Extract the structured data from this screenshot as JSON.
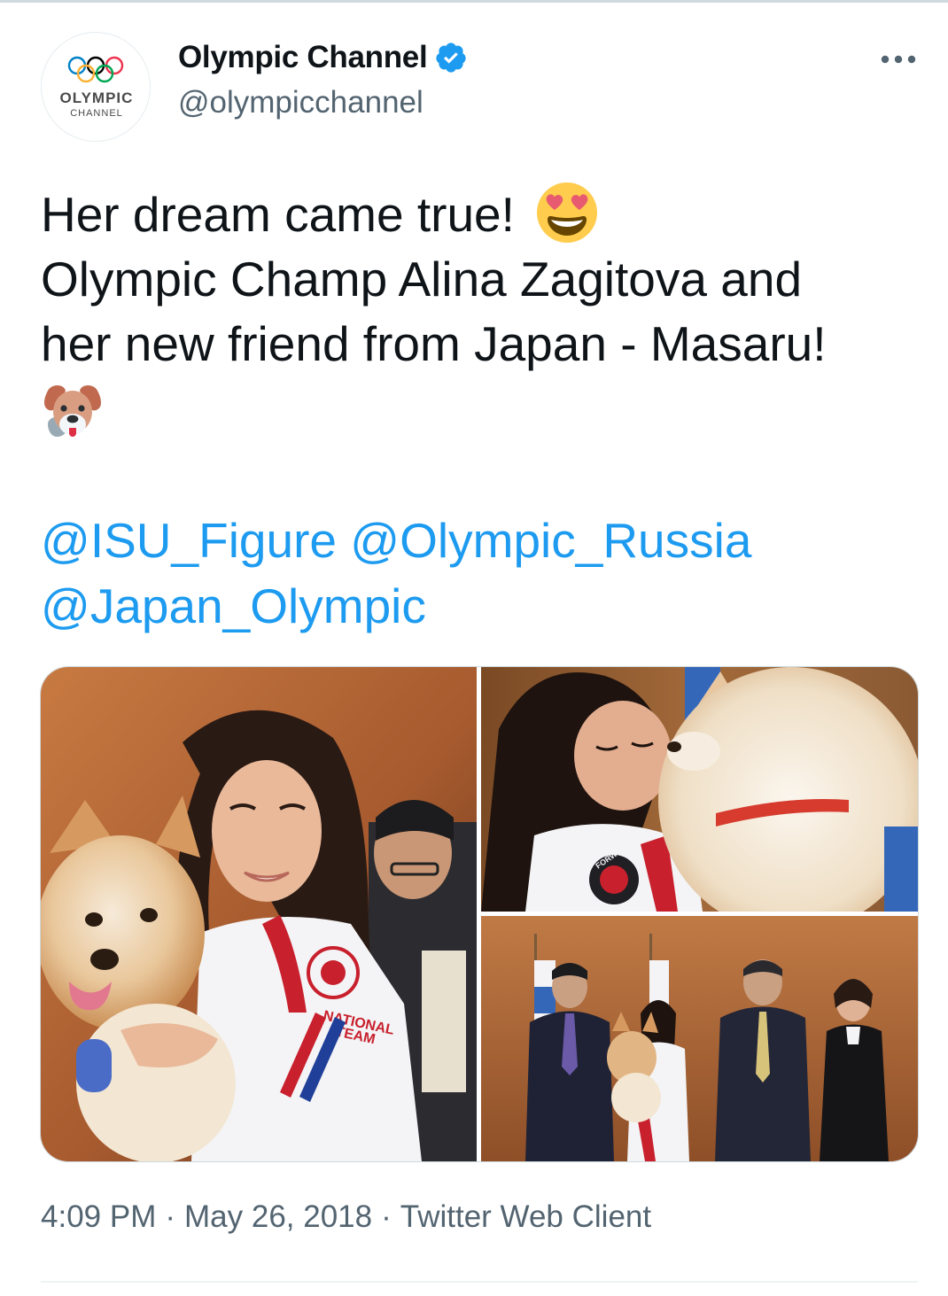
{
  "author": {
    "display_name": "Olympic Channel",
    "handle": "@olympicchannel",
    "verified": true,
    "avatar_text_1": "OLYMPIC",
    "avatar_text_2": "CHANNEL",
    "avatar_icon": "olympic-rings-logo"
  },
  "more_icon": "ellipsis-icon",
  "tweet": {
    "line1": "Her dream came true!",
    "line1_emoji": "smiling-face-with-heart-eyes",
    "line2": "Olympic Champ Alina Zagitova and",
    "line3": "her new friend from Japan - Masaru!",
    "line4_emoji": "dog-face",
    "mentions": [
      "@ISU_Figure",
      "@Olympic_Russia",
      "@Japan_Olympic"
    ]
  },
  "media": [
    {
      "name": "photo-zagitova-holding-puppy"
    },
    {
      "name": "photo-zagitova-kissing-puppy"
    },
    {
      "name": "photo-group-with-officials"
    }
  ],
  "photo_text": {
    "jacket_national": "NATIONAL",
    "jacket_team": "TEAM",
    "badge_forward": "FORWARD"
  },
  "meta": {
    "time": "4:09 PM",
    "date": "May 26, 2018",
    "source": "Twitter Web Client",
    "separator": "·"
  },
  "colors": {
    "link": "#1d9bf0",
    "secondary_text": "#536471",
    "primary_text": "#0f1419",
    "verified": "#1d9bf0"
  }
}
